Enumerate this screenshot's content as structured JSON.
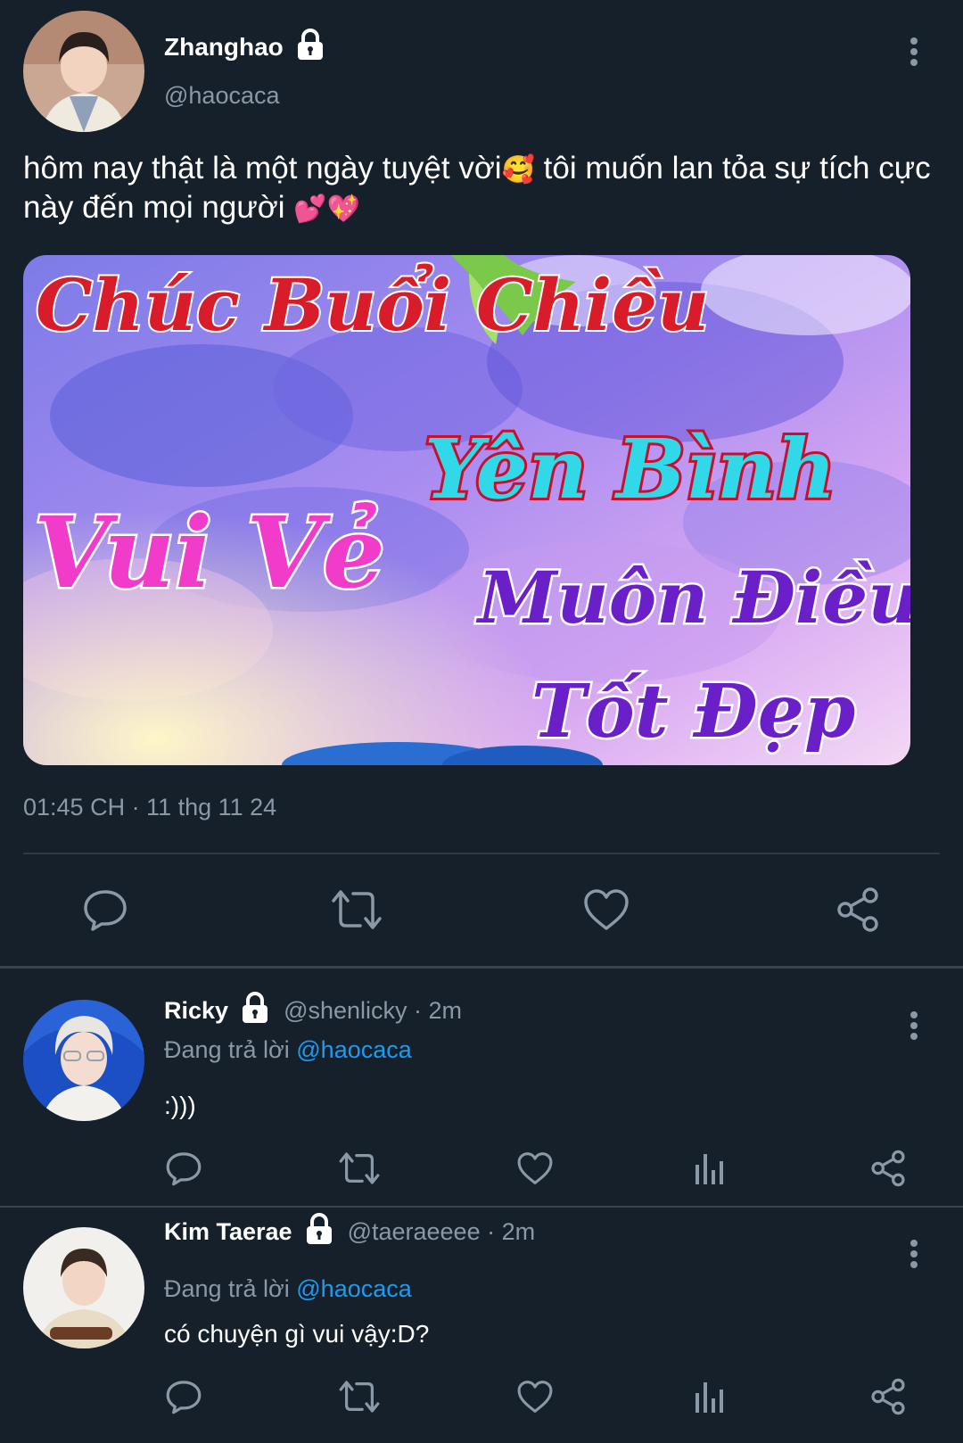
{
  "main_tweet": {
    "display_name": "Zhanghao",
    "handle": "@haocaca",
    "text_part1": "hôm nay thật là một ngày tuyệt vời",
    "emoji1": "🥰",
    "text_part2": " tôi muốn lan tỏa sự tích cực này đến mọi người ",
    "emoji2": "💕💖",
    "media": {
      "line1": "Chúc Buổi Chiều",
      "line2": "Yên Bình",
      "line3": "Vui Vẻ",
      "line4": "Muôn Điều",
      "line5": "Tốt Đẹp"
    },
    "timestamp": "01:45 CH · 11 thg 11 24"
  },
  "replies": [
    {
      "display_name": "Ricky",
      "handle_time": "@shenlicky · 2m",
      "replying_prefix": "Đang trả lời ",
      "replying_to": "@haocaca",
      "text": ":)))"
    },
    {
      "display_name": "Kim Taerae",
      "handle_time": "@taeraeeee · 2m",
      "replying_prefix": "Đang trả lời ",
      "replying_to": "@haocaca",
      "text": "có chuyện gì vui vậy:D?"
    }
  ],
  "icons": [
    "lock-icon",
    "more-icon",
    "reply-icon",
    "retweet-icon",
    "like-icon",
    "share-icon",
    "analytics-icon"
  ],
  "colors": {
    "background": "#15202b",
    "secondary_text": "#8b98a5",
    "link": "#1d9bf0",
    "divider": "#38444d"
  }
}
